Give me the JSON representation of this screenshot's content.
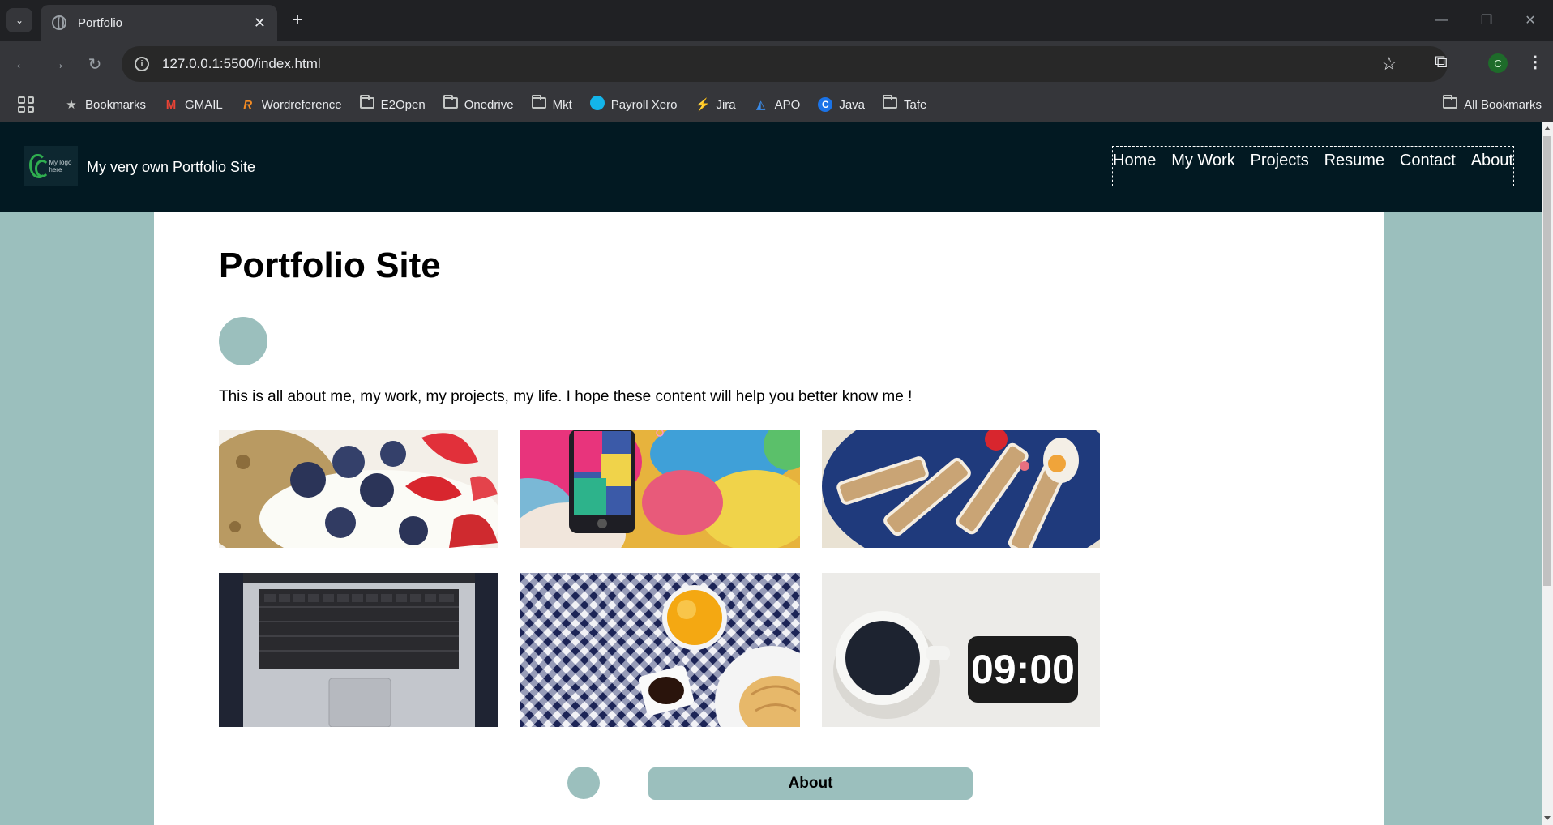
{
  "browser": {
    "tab_title": "Portfolio",
    "url": "127.0.0.1:5500/index.html",
    "profile_initial": "C",
    "bookmarks": [
      {
        "label": "Bookmarks",
        "icon": "star-icon"
      },
      {
        "label": "GMAIL",
        "icon": "gmail-icon"
      },
      {
        "label": "Wordreference",
        "icon": "wordreference-icon"
      },
      {
        "label": "E2Open",
        "icon": "folder-icon"
      },
      {
        "label": "Onedrive",
        "icon": "folder-icon"
      },
      {
        "label": "Mkt",
        "icon": "folder-icon"
      },
      {
        "label": "Payroll Xero",
        "icon": "xero-icon"
      },
      {
        "label": "Jira",
        "icon": "jira-icon"
      },
      {
        "label": "APO",
        "icon": "apo-icon"
      },
      {
        "label": "Java",
        "icon": "java-icon"
      },
      {
        "label": "Tafe",
        "icon": "folder-icon"
      }
    ],
    "all_bookmarks_label": "All Bookmarks"
  },
  "site": {
    "logo_text": "My logo here",
    "name": "My very own Portfolio Site",
    "nav": [
      "Home",
      "My Work",
      "Projects",
      "Resume",
      "Contact",
      "About"
    ],
    "colors": {
      "header_bg": "#021922",
      "accent": "#9bbfbd",
      "logo_green": "#2fae4f"
    }
  },
  "main": {
    "title": "Portfolio Site",
    "intro": "This is all about me, my work, my projects, my life. I hope these content will help you better know me !",
    "gallery": [
      {
        "alt": "yogurt with berries"
      },
      {
        "alt": "phone photographing colorful wall"
      },
      {
        "alt": "breakfast toast plate"
      },
      {
        "alt": "laptop keyboard"
      },
      {
        "alt": "orange juice on checkered tablecloth"
      },
      {
        "alt": "coffee cup and clock"
      }
    ],
    "clock_text": "09:00",
    "about_button": "About"
  }
}
